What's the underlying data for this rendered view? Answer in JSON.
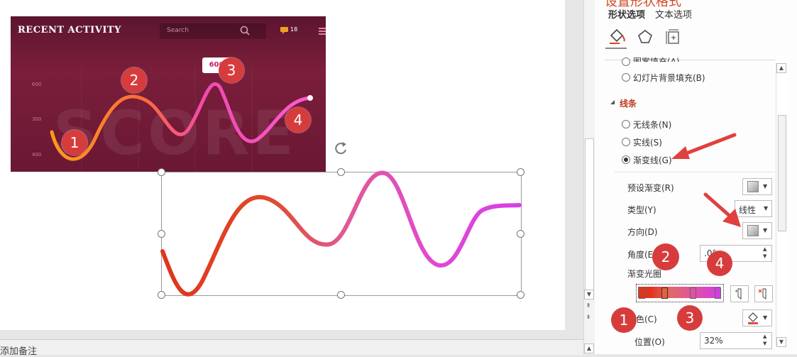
{
  "panel": {
    "title": "设置形状格式",
    "tabs": [
      "形状选项",
      "文本选项"
    ],
    "fill_options": [
      "图案填充(A)",
      "幻灯片背景填充(B)"
    ],
    "line_section": "线条",
    "line_options": [
      "无线条(N)",
      "实线(S)",
      "渐变线(G)"
    ],
    "selected_line": "渐变线(G)",
    "preset_label": "预设渐变(R)",
    "type_label": "类型(Y)",
    "type_value": "线性",
    "direction_label": "方向(D)",
    "angle_label": "角度(E)",
    "angle_value": ".0°",
    "stops_label": "渐变光圈",
    "color_label": "颜色(C)",
    "position_label": "位置(O)",
    "position_value": "32%"
  },
  "slide": {
    "image": {
      "title": "RECENT ACTIVITY",
      "search_placeholder": "Search",
      "badge": "18",
      "background_word": "SCORE",
      "y_labels": [
        "600",
        "300",
        "400"
      ],
      "tooltip": "600"
    },
    "callouts": [
      "1",
      "2",
      "3",
      "4"
    ]
  },
  "notes": {
    "placeholder": "添加备注"
  },
  "colors": {
    "accent": "#d24726",
    "callout": "#d73c3c",
    "arrow": "#e04040",
    "gradient": [
      "#e0341c",
      "#e06a6a",
      "#e04fa8",
      "#d03ee0"
    ]
  }
}
